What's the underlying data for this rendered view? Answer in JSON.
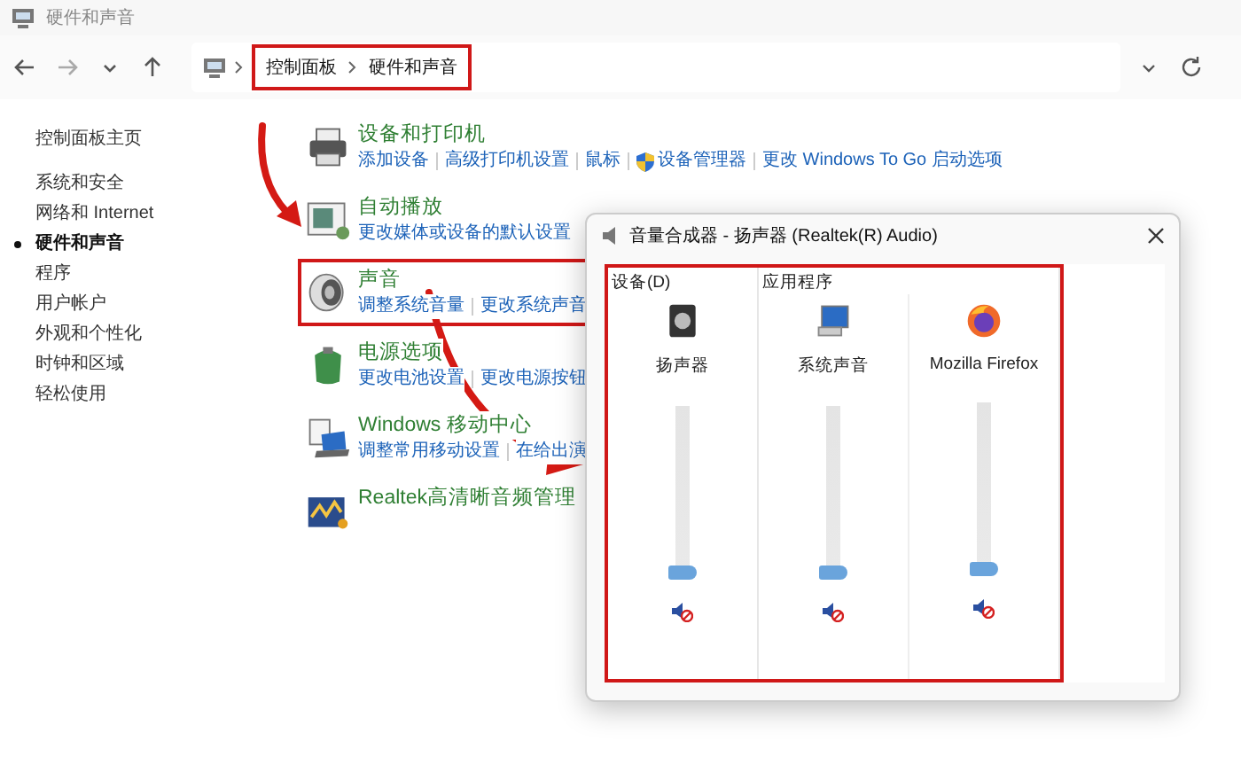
{
  "window": {
    "title": "硬件和声音"
  },
  "address_bar": {
    "breadcrumb": [
      "控制面板",
      "硬件和声音"
    ],
    "highlighted": true
  },
  "sidebar": {
    "items": [
      {
        "label": "控制面板主页",
        "selected": false
      },
      {
        "label": "系统和安全",
        "selected": false
      },
      {
        "label": "网络和 Internet",
        "selected": false
      },
      {
        "label": "硬件和声音",
        "selected": true
      },
      {
        "label": "程序",
        "selected": false
      },
      {
        "label": "用户帐户",
        "selected": false
      },
      {
        "label": "外观和个性化",
        "selected": false
      },
      {
        "label": "时钟和区域",
        "selected": false
      },
      {
        "label": "轻松使用",
        "selected": false
      }
    ]
  },
  "categories": [
    {
      "kind": "printer",
      "title": "设备和打印机",
      "highlighted": false,
      "links": [
        {
          "label": "添加设备",
          "kind": "plain"
        },
        {
          "label": "高级打印机设置",
          "kind": "plain"
        },
        {
          "label": "鼠标",
          "kind": "plain"
        },
        {
          "label": "设备管理器",
          "kind": "shield"
        },
        {
          "label": "更改 Windows To Go 启动选项",
          "kind": "plain"
        }
      ]
    },
    {
      "kind": "autoplay",
      "title": "自动播放",
      "highlighted": false,
      "links": [
        {
          "label": "更改媒体或设备的默认设置",
          "kind": "plain"
        }
      ]
    },
    {
      "kind": "sound",
      "title": "声音",
      "highlighted": true,
      "links": [
        {
          "label": "调整系统音量",
          "kind": "plain"
        },
        {
          "label": "更改系统声音",
          "kind": "plain"
        }
      ]
    },
    {
      "kind": "power",
      "title": "电源选项",
      "highlighted": false,
      "links": [
        {
          "label": "更改电池设置",
          "kind": "plain"
        },
        {
          "label": "更改电源按钮",
          "kind": "plain"
        }
      ]
    },
    {
      "kind": "mobility",
      "title": "Windows 移动中心",
      "highlighted": false,
      "links": [
        {
          "label": "调整常用移动设置",
          "kind": "plain"
        },
        {
          "label": "在给出演",
          "kind": "plain"
        }
      ]
    },
    {
      "kind": "realtek",
      "title": "Realtek高清晰音频管理",
      "highlighted": false
    }
  ],
  "mixer": {
    "title": "音量合成器 - 扬声器 (Realtek(R) Audio)",
    "highlighted": true,
    "sections": [
      {
        "label": "设备(D)",
        "channels": [
          {
            "name": "扬声器",
            "kind": "speaker",
            "level": 0,
            "muted": true
          }
        ]
      },
      {
        "label": "应用程序",
        "channels": [
          {
            "name": "系统声音",
            "kind": "system",
            "level": 0,
            "muted": true
          },
          {
            "name": "Mozilla Firefox",
            "kind": "firefox",
            "level": 0,
            "muted": true
          }
        ]
      }
    ]
  }
}
